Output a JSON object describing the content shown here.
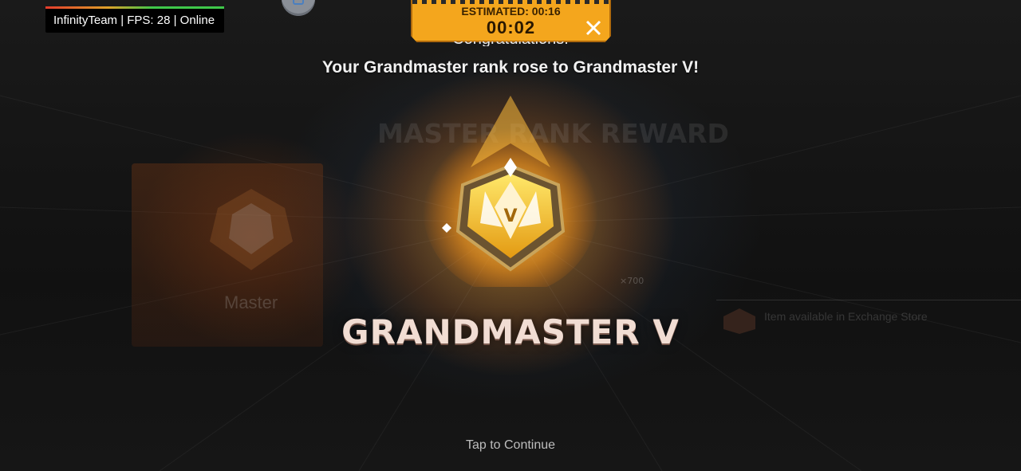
{
  "overlay": {
    "fps_text": "InfinityTeam | FPS: 28 | Online"
  },
  "timer": {
    "estimated": "ESTIMATED: 00:16",
    "elapsed": "00:02"
  },
  "result": {
    "congrats_text": "Congratulations!",
    "message": "Your Grandmaster rank rose to Grandmaster V!",
    "rank_title": "GRANDMASTER V",
    "emblem_tier": "V"
  },
  "background": {
    "reward_title": "MASTER RANK REWARD",
    "previous_rank": "Master",
    "price": "×700",
    "store_note": "Item available in Exchange Store"
  },
  "footer": {
    "continue_label": "Tap to Continue"
  },
  "colors": {
    "accent": "#f4a61d",
    "gold": "#ffd23a",
    "rank_text": "#f1ddd3"
  }
}
